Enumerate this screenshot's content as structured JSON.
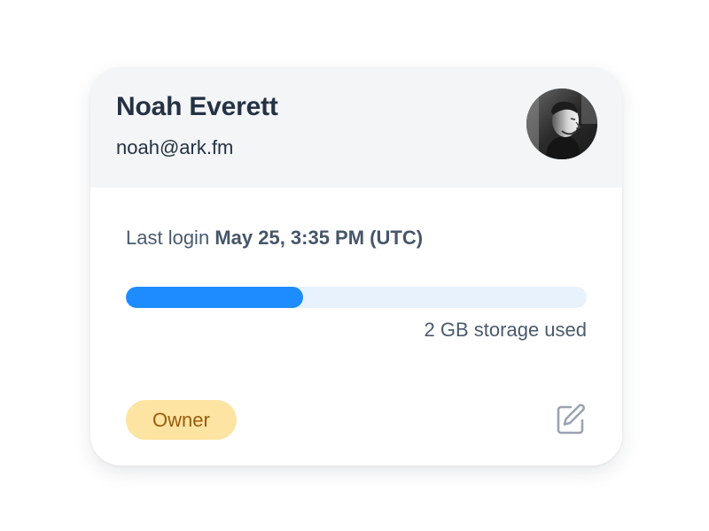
{
  "user": {
    "name": "Noah Everett",
    "email": "noah@ark.fm",
    "avatar_icon": "user-photo"
  },
  "activity": {
    "last_login_label": "Last login",
    "last_login_value": "May 25, 3:35 PM (UTC)"
  },
  "storage": {
    "used_fraction": 0.385,
    "caption": "2 GB storage used",
    "fill_color": "#1e8cff",
    "track_color": "#e8f2fd"
  },
  "role": {
    "label": "Owner",
    "badge_color": "#fde4a3",
    "text_color": "#9b5b0e"
  },
  "actions": {
    "edit_icon": "edit-icon"
  }
}
